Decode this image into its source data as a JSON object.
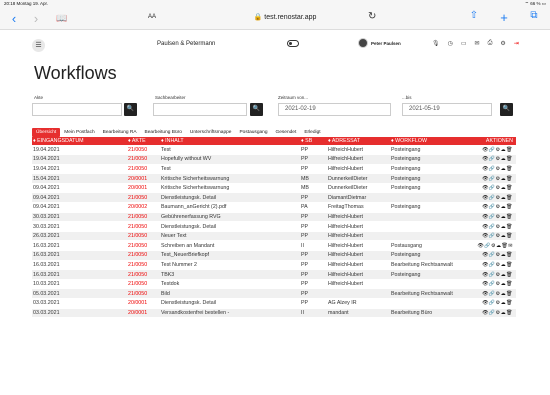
{
  "status": {
    "time": "20:18",
    "date": "Montag 19. Apr.",
    "battery": "66 %"
  },
  "browser": {
    "text_size": "AA",
    "url": "test.renostar.app"
  },
  "app": {
    "firm": "Paulsen & Petermann",
    "user": "Peter Paulsen"
  },
  "page": {
    "title": "Workflows"
  },
  "filters": {
    "akte_label": "Akte",
    "akte_value": "",
    "bearbeiter_label": "Sachbearbeiter",
    "bearbeiter_value": "",
    "from_label": "Zeitraum von...",
    "from_value": "2021-02-19",
    "to_label": "...bis",
    "to_value": "2021-05-19"
  },
  "tabs": [
    "Übersicht",
    "Mein Postfach",
    "Bearbeitung RA",
    "Bearbeitung Büro",
    "Unterschriftsmappe",
    "Postausgang",
    "Gesendet",
    "Erledigt"
  ],
  "active_tab": 0,
  "columns": {
    "date": "♦ EINGANGSDATUM",
    "akte": "♦ AKTE",
    "inhalt": "♦ INHALT",
    "sb": "♦ SB",
    "adressat": "♦ ADRESSAT",
    "workflow": "♦ WORKFLOW",
    "aktionen": "AKTIONEN"
  },
  "rows": [
    {
      "date": "19.04.2021",
      "akte": "21/0050",
      "inhalt": "Test",
      "sb": "PP",
      "adressat": "HilfreichHubert",
      "workflow": "Posteingang",
      "icons": "👁🔗⚙☁🗑"
    },
    {
      "date": "19.04.2021",
      "akte": "21/0050",
      "inhalt": "Hopefully without WV",
      "sb": "PP",
      "adressat": "HilfreichHubert",
      "workflow": "Posteingang",
      "icons": "👁🔗⚙☁🗑"
    },
    {
      "date": "19.04.2021",
      "akte": "21/0050",
      "inhalt": "Test",
      "sb": "PP",
      "adressat": "HilfreichHubert",
      "workflow": "Posteingang",
      "icons": "👁🔗⚙☁🗑"
    },
    {
      "date": "15.04.2021",
      "akte": "20/0001",
      "inhalt": "Kritische Sicherheitswarnung",
      "sb": "MB",
      "adressat": "DunnerkeilDieter",
      "workflow": "Posteingang",
      "icons": "👁🔗⚙☁🗑"
    },
    {
      "date": "09.04.2021",
      "akte": "20/0001",
      "inhalt": "Kritische Sicherheitswarnung",
      "sb": "MB",
      "adressat": "DunnerkeilDieter",
      "workflow": "Posteingang",
      "icons": "👁🔗⚙☁🗑"
    },
    {
      "date": "09.04.2021",
      "akte": "21/0050",
      "inhalt": "Dienstleistungsk. Detail",
      "sb": "PP",
      "adressat": "DiamantDietmar",
      "workflow": "",
      "icons": "👁🔗⚙☁🗑"
    },
    {
      "date": "09.04.2021",
      "akte": "20/0002",
      "inhalt": "Baumann_anGericht (2).pdf",
      "sb": "PA",
      "adressat": "FreitagThomas",
      "workflow": "Posteingang",
      "icons": "👁🔗⚙☁🗑"
    },
    {
      "date": "30.03.2021",
      "akte": "21/0050",
      "inhalt": "Gebührenerfassung RVG",
      "sb": "PP",
      "adressat": "HilfreichHubert",
      "workflow": "",
      "icons": "👁🔗⚙☁🗑"
    },
    {
      "date": "30.03.2021",
      "akte": "21/0050",
      "inhalt": "Dienstleistungsk. Detail",
      "sb": "PP",
      "adressat": "HilfreichHubert",
      "workflow": "",
      "icons": "👁🔗⚙☁🗑"
    },
    {
      "date": "26.03.2021",
      "akte": "21/0050",
      "inhalt": "Neuer Text",
      "sb": "PP",
      "adressat": "HilfreichHubert",
      "workflow": "",
      "icons": "👁🔗⚙☁🗑"
    },
    {
      "date": "16.03.2021",
      "akte": "21/0050",
      "inhalt": "Schreiben an Mandant",
      "sb": "II",
      "adressat": "HilfreichHubert",
      "workflow": "Postausgang",
      "icons": "👁🔗⚙☁🗑✉"
    },
    {
      "date": "16.03.2021",
      "akte": "21/0050",
      "inhalt": "Test_NeuerBriefkopf",
      "sb": "PP",
      "adressat": "HilfreichHubert",
      "workflow": "Posteingang",
      "icons": "👁🔗⚙☁🗑"
    },
    {
      "date": "16.03.2021",
      "akte": "21/0050",
      "inhalt": "Test Nummer 2",
      "sb": "PP",
      "adressat": "HilfreichHubert",
      "workflow": "Bearbeitung Rechtsanwalt",
      "icons": "👁🔗⚙☁🗑"
    },
    {
      "date": "16.03.2021",
      "akte": "21/0050",
      "inhalt": "TBK3",
      "sb": "PP",
      "adressat": "HilfreichHubert",
      "workflow": "Posteingang",
      "icons": "👁🔗⚙☁🗑"
    },
    {
      "date": "10.03.2021",
      "akte": "21/0050",
      "inhalt": "Testdok",
      "sb": "PP",
      "adressat": "HilfreichHubert",
      "workflow": "",
      "icons": "👁🔗⚙☁🗑"
    },
    {
      "date": "05.03.2021",
      "akte": "21/0050",
      "inhalt": "Bild",
      "sb": "PP",
      "adressat": "",
      "workflow": "Bearbeitung Rechtsanwalt",
      "icons": "👁🔗⚙☁🗑"
    },
    {
      "date": "03.03.2021",
      "akte": "20/0001",
      "inhalt": "Dienstleistungsk. Detail",
      "sb": "PP",
      "adressat": "AG Alzey IR",
      "workflow": "",
      "icons": "👁🔗⚙☁🗑"
    },
    {
      "date": "03.03.2021",
      "akte": "20/0001",
      "inhalt": "Versandkostenfrei bestellen -",
      "sb": "II",
      "adressat": "mandant",
      "workflow": "Bearbeitung Büro",
      "icons": "👁🔗⚙☁🗑"
    }
  ]
}
